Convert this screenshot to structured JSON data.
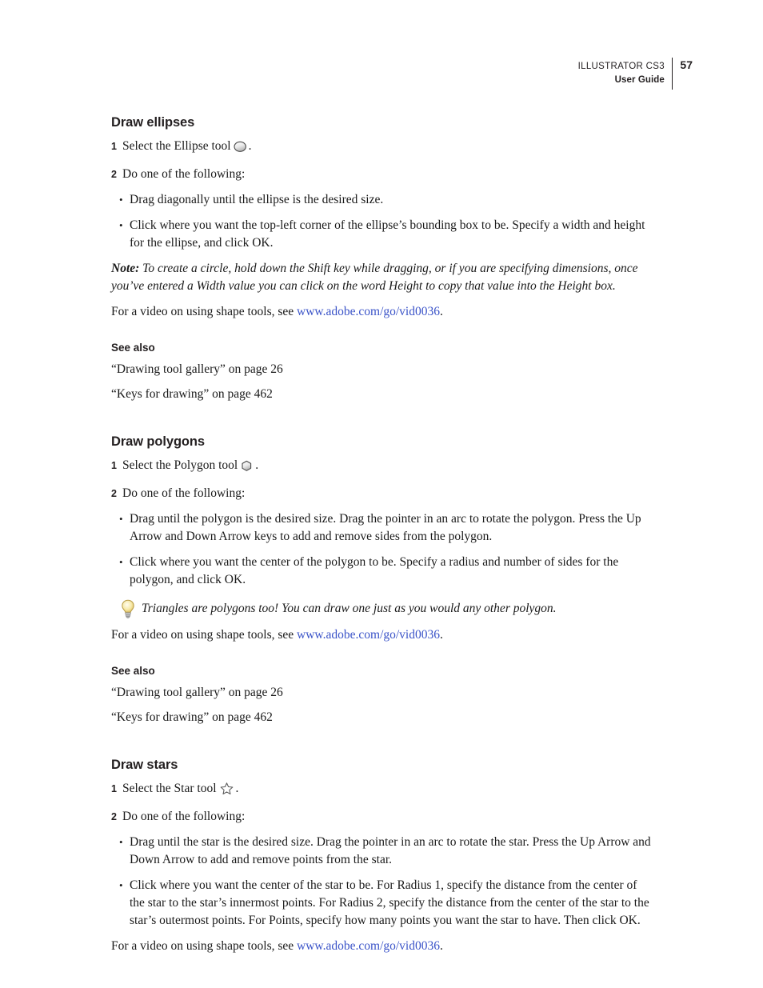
{
  "header": {
    "product": "ILLUSTRATOR CS3",
    "guide": "User Guide",
    "page_number": "57"
  },
  "sections": [
    {
      "title": "Draw ellipses",
      "steps": [
        {
          "num": "1",
          "before": "Select the Ellipse tool",
          "icon": "ellipse-tool-icon",
          "after": "."
        },
        {
          "num": "2",
          "before": "Do one of the following:",
          "icon": null,
          "after": ""
        }
      ],
      "bullets": [
        "Drag diagonally until the ellipse is the desired size.",
        "Click where you want the top-left corner of the ellipse’s bounding box to be. Specify a width and height for the ellipse, and click OK."
      ],
      "note_label": "Note:",
      "note_text": " To create a circle, hold down the Shift key while dragging, or if you are specifying dimensions, once you’ve entered a Width value you can click on the word Height to copy that value into the Height box.",
      "tip_text": null,
      "video_prefix": "For a video on using shape tools, see ",
      "video_link": "www.adobe.com/go/vid0036",
      "video_suffix": ".",
      "see_also_title": "See also",
      "see_also": [
        "“Drawing tool gallery” on page 26",
        "“Keys for drawing” on page 462"
      ]
    },
    {
      "title": "Draw polygons",
      "steps": [
        {
          "num": "1",
          "before": "Select the Polygon tool",
          "icon": "polygon-tool-icon",
          "after": "."
        },
        {
          "num": "2",
          "before": "Do one of the following:",
          "icon": null,
          "after": ""
        }
      ],
      "bullets": [
        "Drag until the polygon is the desired size. Drag the pointer in an arc to rotate the polygon. Press the Up Arrow and Down Arrow keys to add and remove sides from the polygon.",
        "Click where you want the center of the polygon to be. Specify a radius and number of sides for the polygon, and click OK."
      ],
      "note_label": null,
      "note_text": null,
      "tip_text": "Triangles are polygons too! You can draw one just as you would any other polygon.",
      "video_prefix": "For a video on using shape tools, see ",
      "video_link": "www.adobe.com/go/vid0036",
      "video_suffix": ".",
      "see_also_title": "See also",
      "see_also": [
        "“Drawing tool gallery” on page 26",
        "“Keys for drawing” on page 462"
      ]
    },
    {
      "title": "Draw stars",
      "steps": [
        {
          "num": "1",
          "before": "Select the Star tool",
          "icon": "star-tool-icon",
          "after": "."
        },
        {
          "num": "2",
          "before": "Do one of the following:",
          "icon": null,
          "after": ""
        }
      ],
      "bullets": [
        "Drag until the star is the desired size. Drag the pointer in an arc to rotate the star. Press the Up Arrow and Down Arrow to add and remove points from the star.",
        "Click where you want the center of the star to be. For Radius 1, specify the distance from the center of the star to the star’s innermost points. For Radius 2, specify the distance from the center of the star to the star’s outermost points. For Points, specify how many points you want the star to have. Then click OK."
      ],
      "note_label": null,
      "note_text": null,
      "tip_text": null,
      "video_prefix": "For a video on using shape tools, see ",
      "video_link": "www.adobe.com/go/vid0036",
      "video_suffix": ".",
      "see_also_title": null,
      "see_also": []
    }
  ],
  "colors": {
    "link": "#3a53c8",
    "text": "#1a1a1a",
    "header_text": "#231f20",
    "tip_bulb": "#f2d97a"
  }
}
